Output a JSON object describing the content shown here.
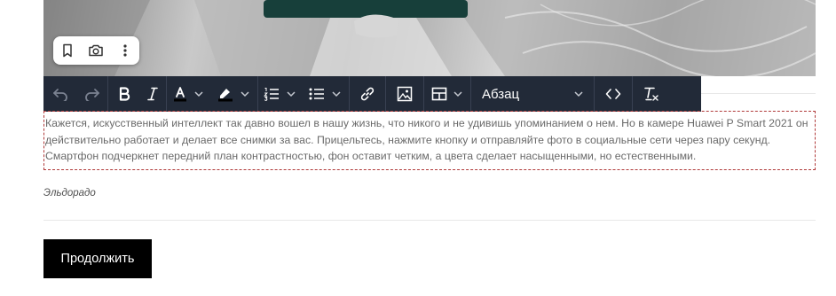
{
  "editor": {
    "format_select": {
      "selected": "Абзац"
    },
    "paragraph_text": "Кажется, искусственный интеллект так давно вошел в нашу жизнь, что никого и не удивишь упоминанием о нем. Но в камере Huawei P Smart 2021 он действительно работает и делает все снимки за вас. Прицельтесь, нажмите кнопку и отправляйте фото в социальные сети через пару секунд. Смартфон подчеркнет передний план контрастностью, фон оставит четким, а цвета сделает насыщенными, но естественными.",
    "caption": "Эльдорадо"
  },
  "image_toolbar": {
    "icons": [
      "bookmark-icon",
      "camera-icon",
      "more-vertical-icon"
    ]
  },
  "toolbar_icons": [
    "undo-icon",
    "redo-icon",
    "bold-icon",
    "italic-icon",
    "text-color-icon",
    "highlight-icon",
    "numbered-list-icon",
    "bulleted-list-icon",
    "link-icon",
    "image-icon",
    "table-icon",
    "code-icon",
    "clear-formatting-icon"
  ],
  "colors": {
    "toolbar_bg": "#222a38",
    "text_color_swatch": "#000000",
    "highlight_swatch": "#000000",
    "button_bg": "#000000"
  },
  "actions": {
    "continue_label": "Продолжить"
  }
}
